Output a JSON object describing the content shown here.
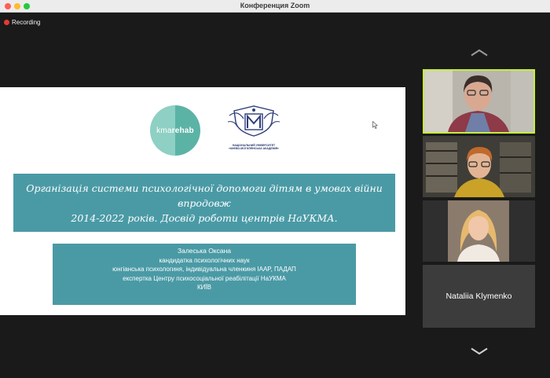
{
  "window": {
    "title": "Конференция Zoom"
  },
  "recording": {
    "label": "Recording"
  },
  "slide": {
    "logo_left": "kma",
    "logo_right": "rehab",
    "seal_caption_1": "НАЦІОНАЛЬНИЙ УНІВЕРСИТЕТ",
    "seal_caption_2": "«КИЄВО-МОГИЛЯНСЬКА АКАДЕМІЯ»",
    "title_line_1": "Організація системи психологічної допомоги дітям в умовах війни впродовж",
    "title_line_2": "2014-2022 років. Досвід роботи центрів НаУКМА.",
    "author": {
      "name": "Залеська Оксана",
      "degree": "кандидатка психологічних наук",
      "membership": "юнгіанська психологиня, індивідуальна членкиня IAAP, ПАДАП",
      "role": "експертка Центру психосоціальної реабілітації НаУКМА",
      "city": "КИЇВ"
    }
  },
  "participants": [
    {
      "name": ""
    },
    {
      "name": ""
    },
    {
      "name": ""
    },
    {
      "name": "Nataliia Klymenko"
    }
  ],
  "colors": {
    "accent_teal": "#4a9aa5",
    "active_speaker_border": "#c4ee3d",
    "recording_red": "#e53935"
  },
  "icons": {
    "scroll_up": "chevron-up-icon",
    "scroll_down": "chevron-down-icon"
  }
}
